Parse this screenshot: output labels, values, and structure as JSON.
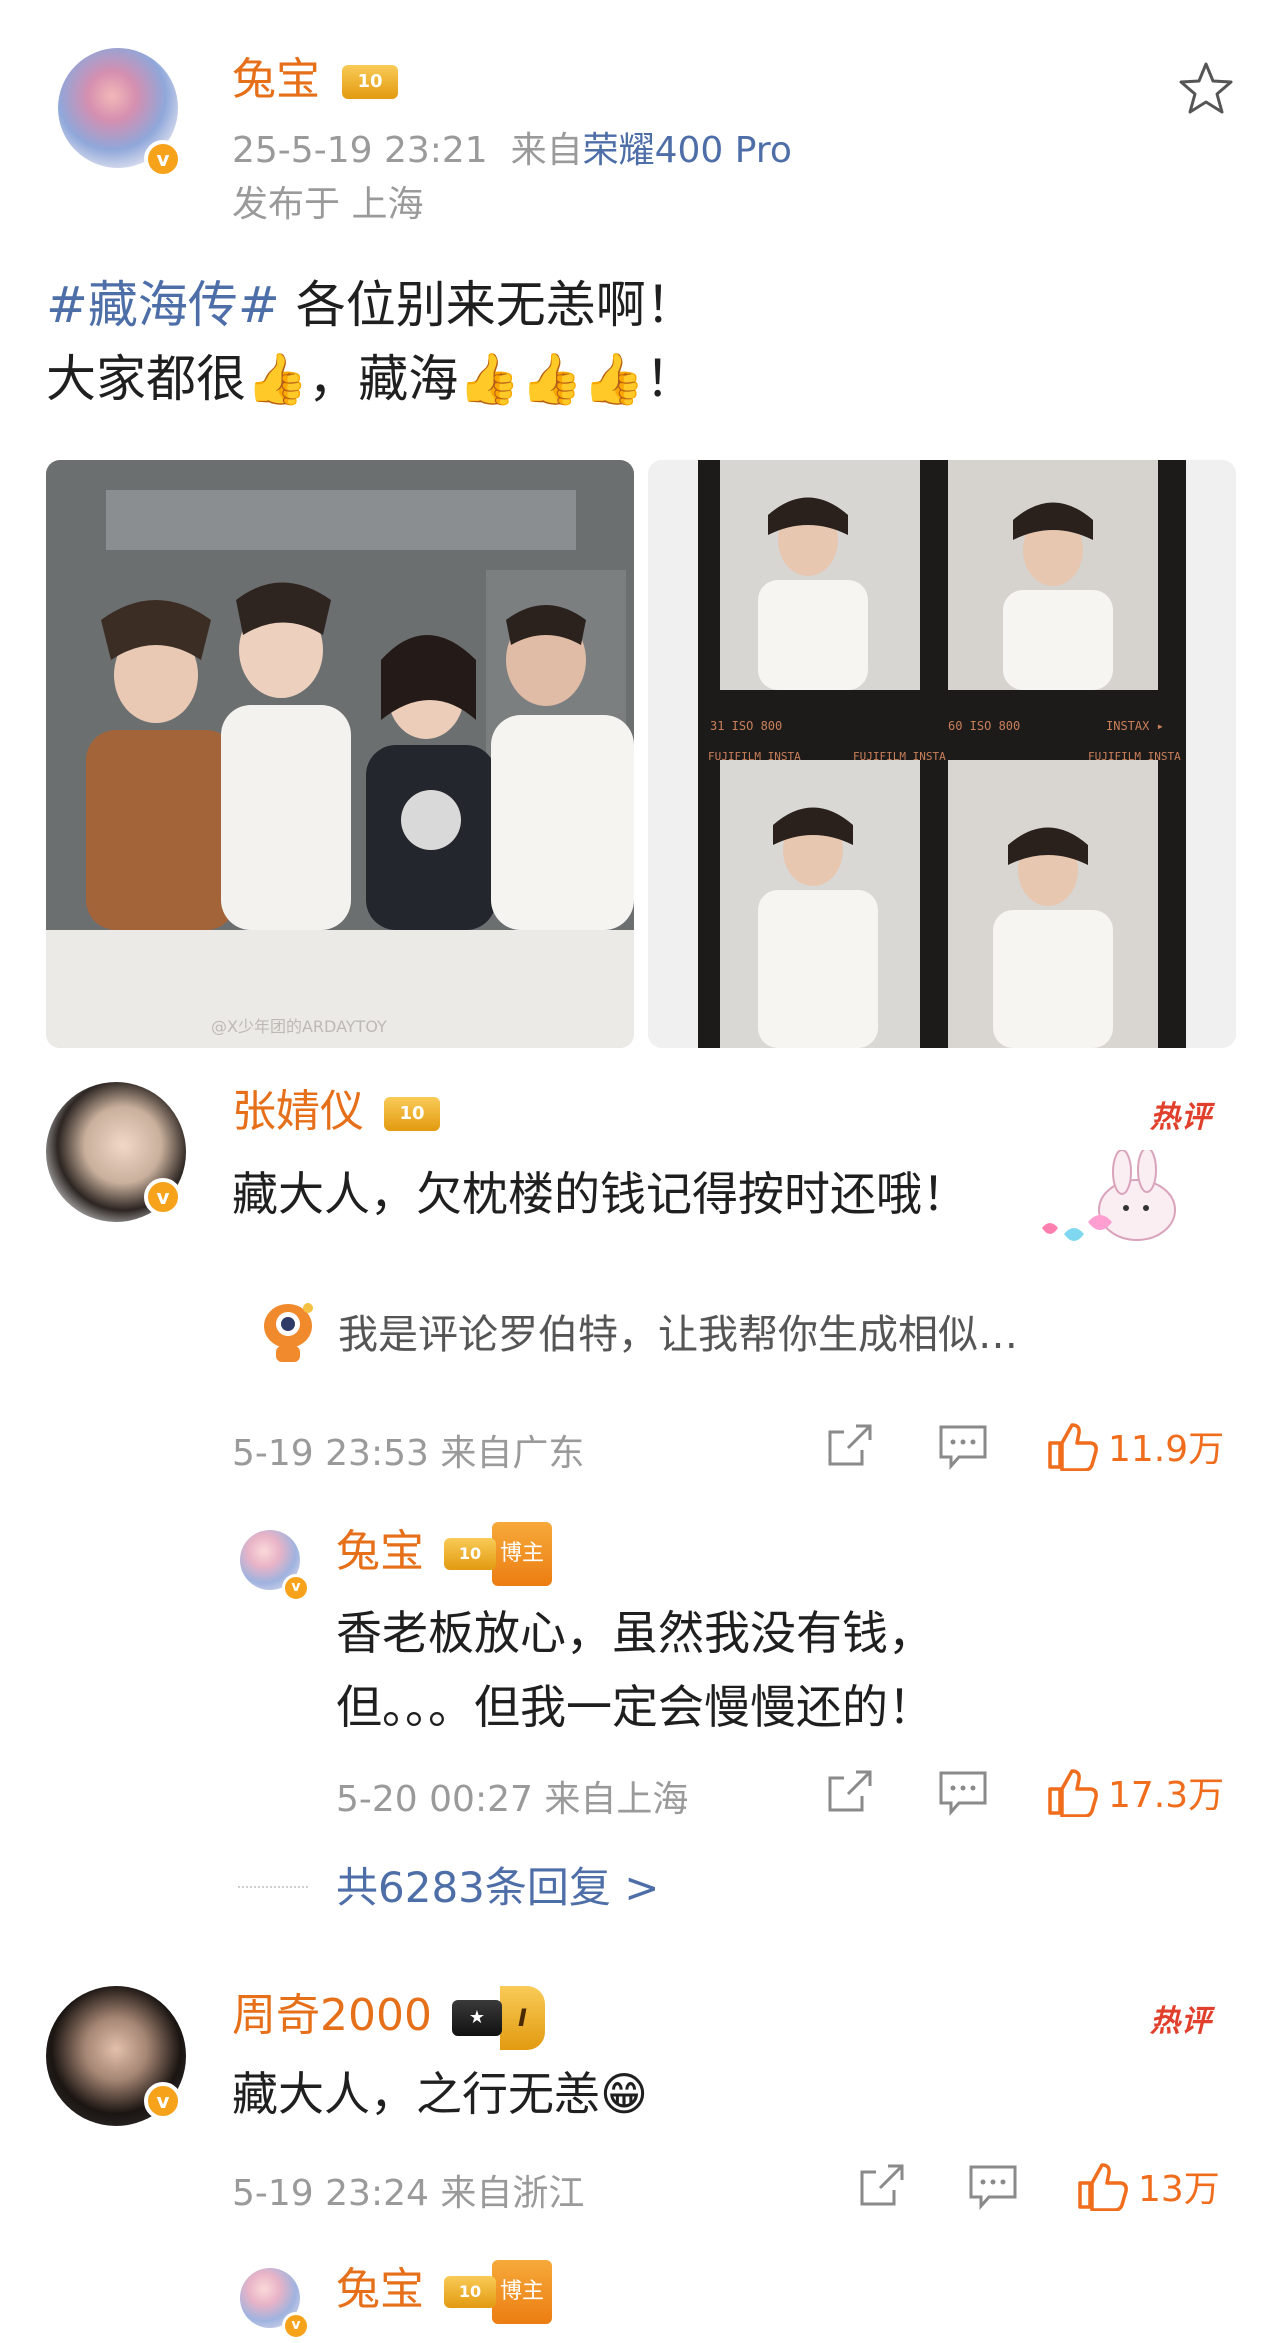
{
  "post": {
    "author_name": "兔宝",
    "author_badge": "10",
    "timestamp": "25-5-19 23:21",
    "source_prefix": "来自",
    "source_device": "荣耀400 Pro",
    "location": "发布于 上海",
    "hashtag": "#藏海传#",
    "line1_rest": " 各位别来无恙啊！",
    "line2_a": "大家都很",
    "line2_b": "，藏海",
    "line2_end": "！",
    "thumb_emoji": "👍"
  },
  "photos": {
    "left_watermark": "@X少年团的ARDAYTOY",
    "film_labels": [
      "31 ISO 800",
      "60 ISO 800",
      "INSTAX ▸",
      "FUJIFILM INSTA",
      "FUJIFILM INSTA",
      "FUJIFILM INSTA"
    ]
  },
  "comments": [
    {
      "name": "张婧仪",
      "badge": "10",
      "hot_label": "热评",
      "text": "藏大人，欠枕楼的钱记得按时还哦！",
      "ai_suggestion": "我是评论罗伯特，让我帮你生成相似…",
      "time": "5-19 23:53",
      "region": "来自广东",
      "likes": "11.9万",
      "reply": {
        "name": "兔宝",
        "badge": "10",
        "tag": "博主",
        "text_line1": "香老板放心，虽然我没有钱，",
        "text_line2": "但。。。但我一定会慢慢还的！",
        "time": "5-20 00:27",
        "region": "来自上海",
        "likes": "17.3万"
      },
      "more_replies": "共6283条回复 >"
    },
    {
      "name": "周奇2000",
      "level": "I",
      "hot_label": "热评",
      "text": "藏大人，之行无恙",
      "emoji": "😁",
      "time": "5-19 23:24",
      "region": "来自浙江",
      "likes": "13万",
      "reply": {
        "name": "兔宝",
        "badge": "10",
        "tag": "博主"
      }
    }
  ],
  "colors": {
    "accent_orange": "#e66f1a",
    "link_blue": "#4e6ea8",
    "hot_red": "#e0402c",
    "meta_gray": "#9a9a9a"
  },
  "icons": [
    "star-icon",
    "verified-icon",
    "crown-icon",
    "share-icon",
    "comment-icon",
    "like-icon",
    "robot-icon"
  ]
}
